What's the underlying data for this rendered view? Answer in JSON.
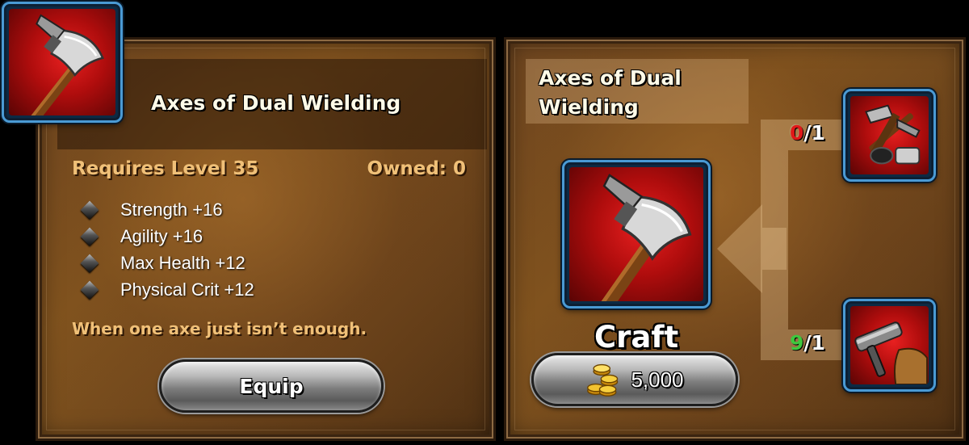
{
  "item": {
    "name": "Axes of Dual Wielding",
    "requires": "Requires Level 35",
    "owned": "Owned: 0",
    "stats": [
      "Strength +16",
      "Agility +16",
      "Max Health +12",
      "Physical Crit +12"
    ],
    "flavor": "When one axe just isn’t enough.",
    "icon": "dual-axe-icon"
  },
  "actions": {
    "equip_label": "Equip"
  },
  "recipe": {
    "title_line1": "Axes of Dual",
    "title_line2": "Wielding",
    "craft_label": "Craft",
    "cost": "5,000",
    "cost_icon": "gold-coins-icon",
    "materials": [
      {
        "icon": "hammer-pick-icon",
        "have": "0",
        "need": "1",
        "status_color": "#e01818"
      },
      {
        "icon": "hammer-icon",
        "have": "9",
        "need": "1",
        "status_color": "#3ec83e"
      }
    ]
  }
}
